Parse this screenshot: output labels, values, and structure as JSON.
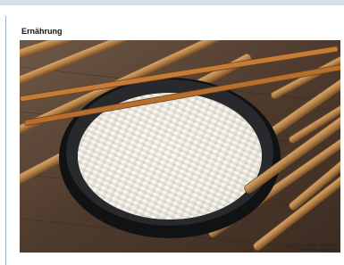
{
  "page": {
    "section_title": "Ernährung",
    "image": {
      "subject": "rice-bowl-with-chopsticks",
      "credit_line1": "© Kurt F. Domnik / pixelio.de",
      "credit_line2": "wiki.wissenstrails.de"
    }
  },
  "colors": {
    "accent_rule": "#9db0cf",
    "top_bar": "#d9dfe8",
    "bamboo": "#b7834a",
    "bowl": "#1d1f22",
    "rice": "#f1efe8"
  }
}
